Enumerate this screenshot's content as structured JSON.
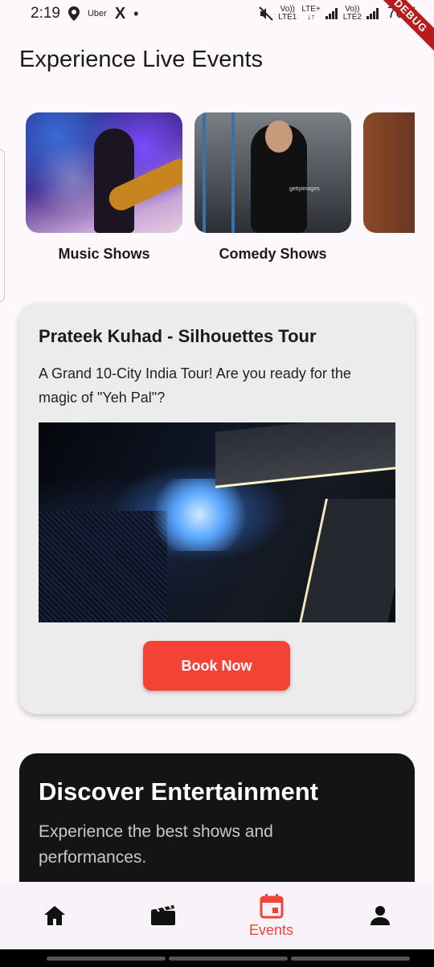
{
  "status_bar": {
    "time": "2:19",
    "uber_label": "Uber",
    "x_label": "X",
    "dot": "•",
    "net1_top": "Vo))",
    "net1_bottom": "LTE1",
    "net2_top": "LTE+",
    "net2_bottom": "↓↑",
    "net3_top": "Vo))",
    "net3_bottom": "LTE2",
    "battery": "70%",
    "debug_banner": "DEBUG"
  },
  "page_title": "Experience Live Events",
  "categories": [
    {
      "label": "Music Shows"
    },
    {
      "label": "Comedy Shows"
    }
  ],
  "comedy_watermark": "gettyimages",
  "featured_event": {
    "title": "Prateek Kuhad - Silhouettes Tour",
    "description": "A Grand 10-City India Tour! Are you ready for the magic of \"Yeh Pal\"?",
    "button_label": "Book Now"
  },
  "discover": {
    "title": "Discover Entertainment",
    "subtitle": "Experience the best shows and performances."
  },
  "bottom_nav": {
    "active": "events",
    "items": [
      {
        "icon": "home-icon",
        "label": ""
      },
      {
        "icon": "movie-icon",
        "label": ""
      },
      {
        "icon": "event-calendar-icon",
        "label": "Events"
      },
      {
        "icon": "person-icon",
        "label": ""
      }
    ]
  },
  "colors": {
    "accent": "#f44336",
    "card_bg": "#ececec",
    "discover_bg": "#141414",
    "page_bg": "#fcf8fc"
  }
}
